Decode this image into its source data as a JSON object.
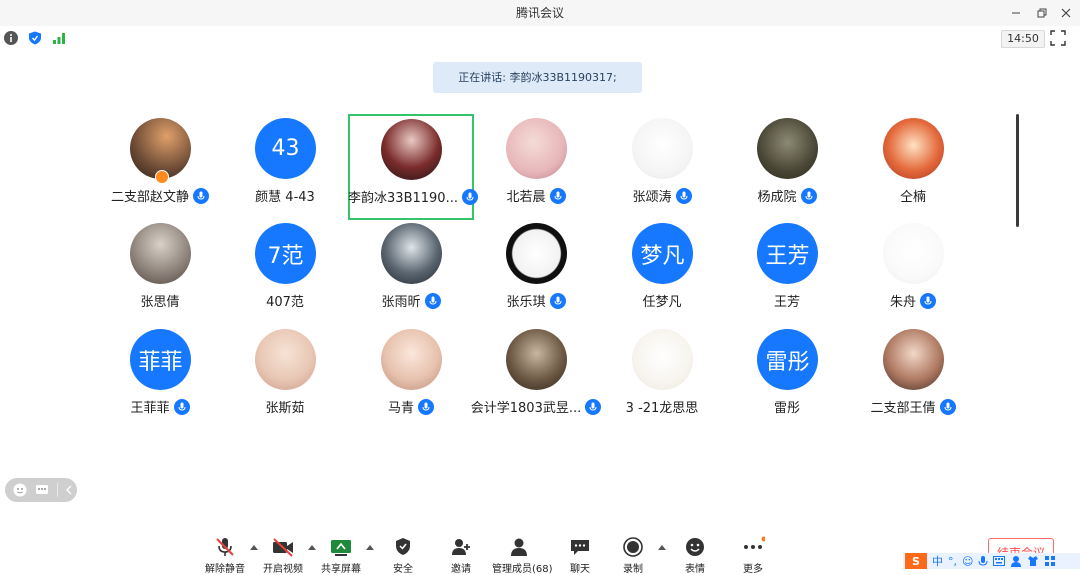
{
  "window": {
    "title": "腾讯会议"
  },
  "status": {
    "time": "14:50"
  },
  "speaking": {
    "text": "正在讲话: 李韵冰33B1190317;"
  },
  "participants": [
    {
      "name": "二支部赵文静",
      "avatar": "photo",
      "mic": true,
      "host": true
    },
    {
      "name": "颜慧  4-43",
      "avatar": "text",
      "avatar_text": "43",
      "mic": false
    },
    {
      "name": "李韵冰33B1190...",
      "avatar": "photo",
      "mic": true,
      "speaking": true
    },
    {
      "name": "北若晨",
      "avatar": "photo",
      "mic": true
    },
    {
      "name": "张颂涛",
      "avatar": "photo",
      "mic": true
    },
    {
      "name": "杨成院",
      "avatar": "photo",
      "mic": true
    },
    {
      "name": "仝楠",
      "avatar": "photo",
      "mic": false
    },
    {
      "name": "张思倩",
      "avatar": "photo",
      "mic": false
    },
    {
      "name": "407范",
      "avatar": "text",
      "avatar_text": "7范",
      "mic": false
    },
    {
      "name": "张雨昕",
      "avatar": "photo",
      "mic": true
    },
    {
      "name": "张乐琪",
      "avatar": "photo",
      "mic": true
    },
    {
      "name": "任梦凡",
      "avatar": "text",
      "avatar_text": "梦凡",
      "mic": false
    },
    {
      "name": "王芳",
      "avatar": "text",
      "avatar_text": "王芳",
      "mic": false
    },
    {
      "name": "朱舟",
      "avatar": "photo",
      "mic": true
    },
    {
      "name": "王菲菲",
      "avatar": "text",
      "avatar_text": "菲菲",
      "mic": true
    },
    {
      "name": "张斯茹",
      "avatar": "photo",
      "mic": false
    },
    {
      "name": "马青",
      "avatar": "photo",
      "mic": true
    },
    {
      "name": "会计学1803武昱...",
      "avatar": "photo",
      "mic": true
    },
    {
      "name": "3 -21龙思思",
      "avatar": "photo",
      "mic": false
    },
    {
      "name": "雷彤",
      "avatar": "text",
      "avatar_text": "雷彤",
      "mic": false
    },
    {
      "name": "二支部王倩",
      "avatar": "photo",
      "mic": true
    }
  ],
  "toolbar": {
    "unmute": "解除静音",
    "video": "开启视频",
    "share": "共享屏幕",
    "security": "安全",
    "invite": "邀请",
    "members": "管理成员(68)",
    "chat": "聊天",
    "record": "录制",
    "reactions": "表情",
    "more": "更多",
    "end": "结束会议"
  },
  "ime": {
    "logo": "S",
    "mode": "中"
  },
  "colors": {
    "accent": "#1677ff",
    "speaker_border": "#35c46a",
    "end": "#ff4d4f"
  }
}
